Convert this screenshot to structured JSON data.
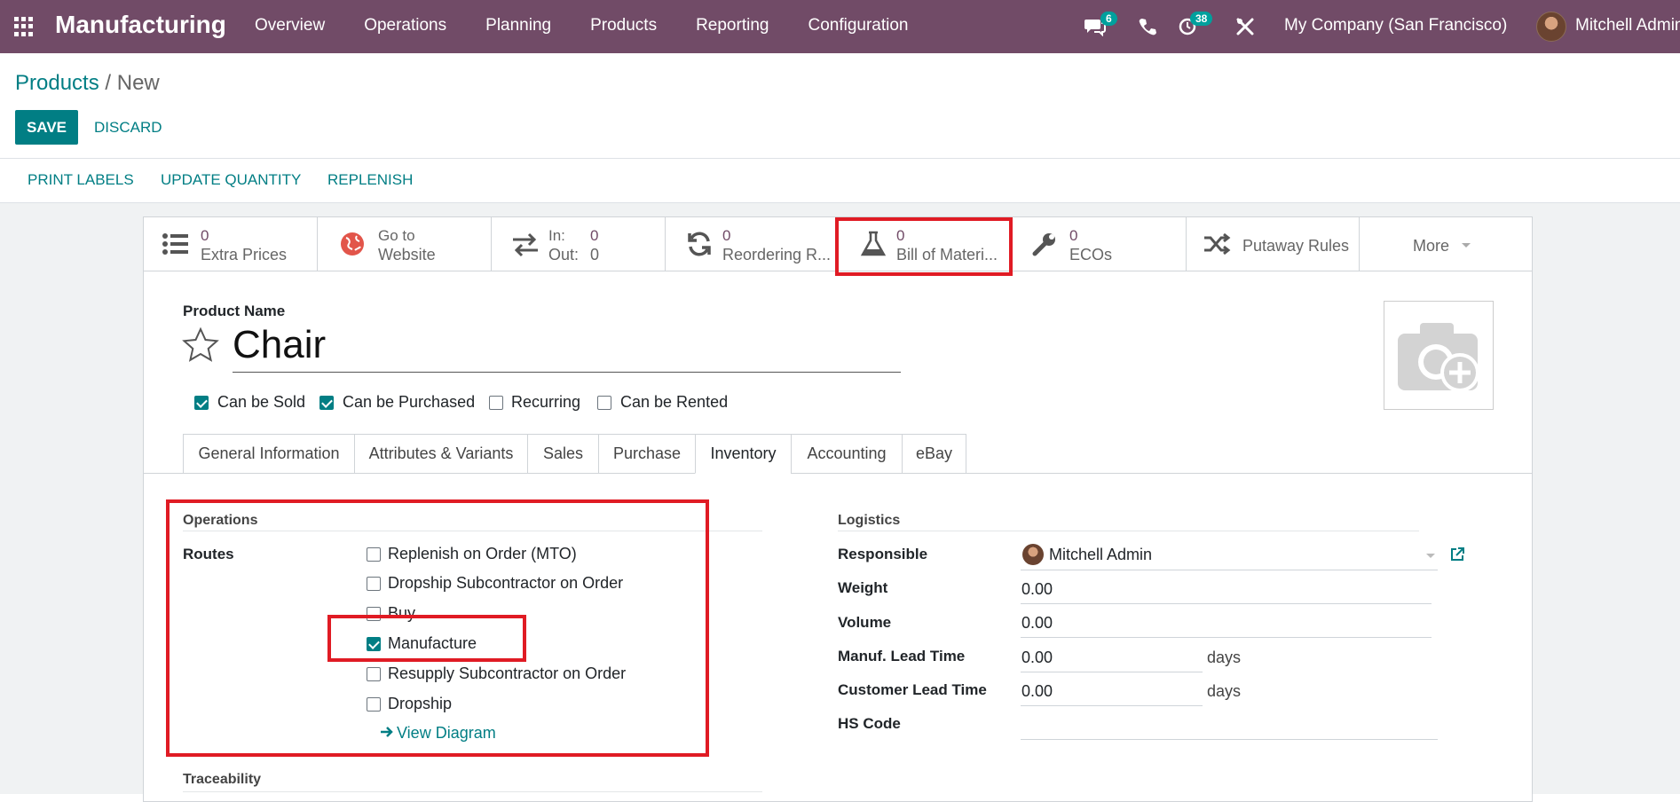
{
  "topbar": {
    "brand": "Manufacturing",
    "menu": [
      "Overview",
      "Operations",
      "Planning",
      "Products",
      "Reporting",
      "Configuration"
    ],
    "messages_count": "6",
    "activities_count": "38",
    "company": "My Company (San Francisco)",
    "user": "Mitchell Admin",
    "bg_color": "#714b67"
  },
  "breadcrumb": {
    "parent": "Products",
    "separator": "/",
    "current": "New"
  },
  "buttons": {
    "save": "SAVE",
    "discard": "DISCARD"
  },
  "actions": [
    "PRINT LABELS",
    "UPDATE QUANTITY",
    "REPLENISH"
  ],
  "smart_buttons": {
    "extra_prices": {
      "value": "0",
      "label": "Extra Prices",
      "icon": "list-icon"
    },
    "website": {
      "line1": "Go to",
      "line2": "Website",
      "icon": "globe-icon"
    },
    "in_out": {
      "in_label": "In:",
      "in_value": "0",
      "out_label": "Out:",
      "out_value": "0",
      "icon": "exchange-icon"
    },
    "reordering": {
      "value": "0",
      "label": "Reordering R...",
      "icon": "refresh-icon"
    },
    "bom": {
      "value": "0",
      "label": "Bill of Materi...",
      "icon": "flask-icon"
    },
    "ecos": {
      "value": "0",
      "label": "ECOs",
      "icon": "wrench-icon"
    },
    "putaway": {
      "label": "Putaway Rules",
      "icon": "random-icon"
    },
    "more": {
      "label": "More"
    }
  },
  "product": {
    "name_label": "Product Name",
    "name": "Chair",
    "flags": [
      {
        "label": "Can be Sold",
        "checked": true
      },
      {
        "label": "Can be Purchased",
        "checked": true
      },
      {
        "label": "Recurring",
        "checked": false
      },
      {
        "label": "Can be Rented",
        "checked": false
      }
    ]
  },
  "tabs": [
    "General Information",
    "Attributes & Variants",
    "Sales",
    "Purchase",
    "Inventory",
    "Accounting",
    "eBay"
  ],
  "active_tab": "Inventory",
  "operations": {
    "title": "Operations",
    "routes_label": "Routes",
    "routes": [
      {
        "label": "Replenish on Order (MTO)",
        "checked": false
      },
      {
        "label": "Dropship Subcontractor on Order",
        "checked": false
      },
      {
        "label": "Buy",
        "checked": false
      },
      {
        "label": "Manufacture",
        "checked": true
      },
      {
        "label": "Resupply Subcontractor on Order",
        "checked": false
      },
      {
        "label": "Dropship",
        "checked": false
      }
    ],
    "view_diagram": "View Diagram"
  },
  "traceability": {
    "title": "Traceability"
  },
  "logistics": {
    "title": "Logistics",
    "responsible_label": "Responsible",
    "responsible": "Mitchell Admin",
    "weight_label": "Weight",
    "weight": "0.00",
    "volume_label": "Volume",
    "volume": "0.00",
    "manuf_lead_label": "Manuf. Lead Time",
    "manuf_lead": "0.00",
    "customer_lead_label": "Customer Lead Time",
    "customer_lead": "0.00",
    "days": "days",
    "hs_code_label": "HS Code",
    "hs_code": ""
  },
  "colors": {
    "accent": "#017e84",
    "highlight": "#e01b24"
  }
}
